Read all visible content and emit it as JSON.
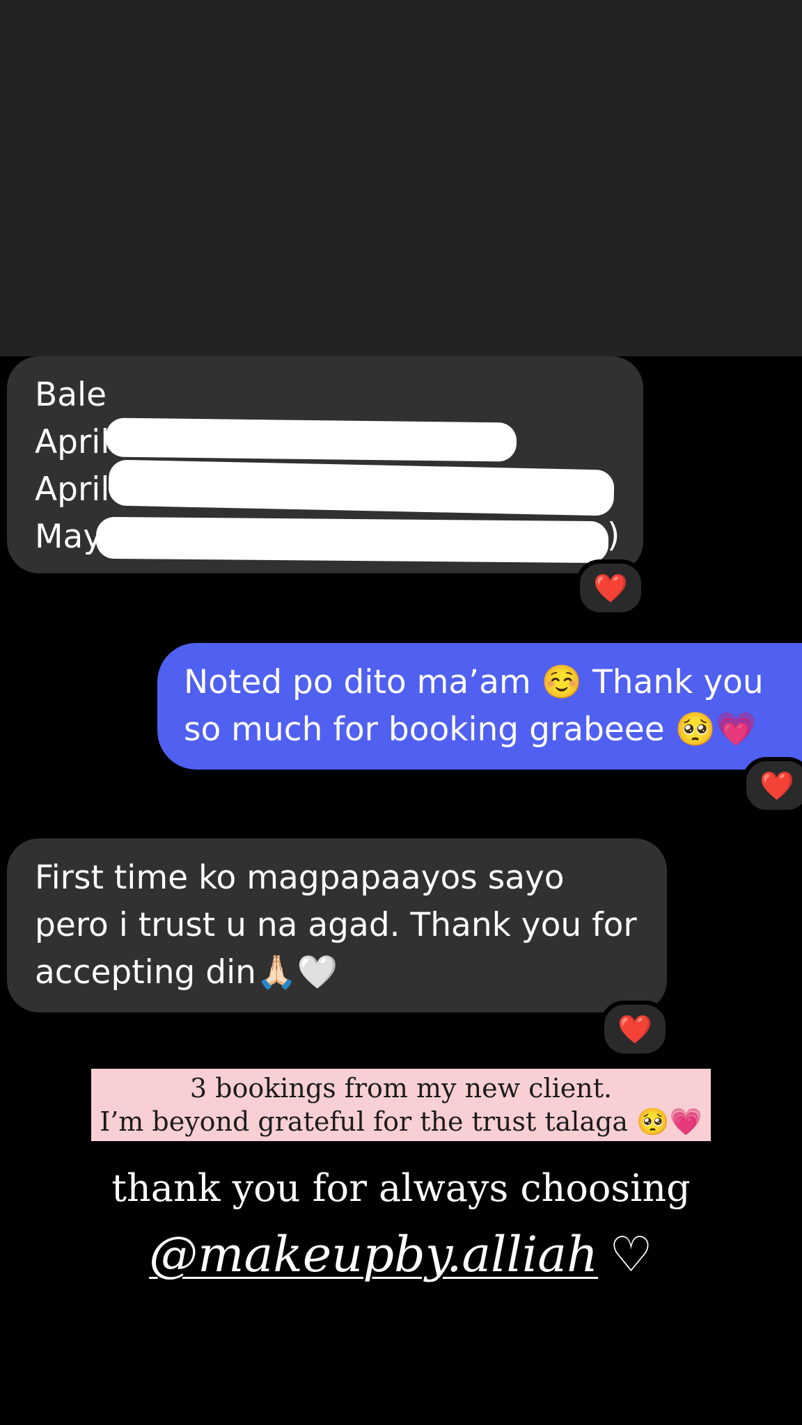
{
  "colors": {
    "top_band": "#232323",
    "background": "#000000",
    "incoming_bubble": "#313131",
    "outgoing_bubble": "#5060f0",
    "caption_bg": "#f8cfd3",
    "reaction": "#e5262d"
  },
  "messages": [
    {
      "direction": "incoming",
      "lines": [
        "Bale",
        "April",
        "April",
        "May",
        ")"
      ],
      "reaction": "❤️"
    },
    {
      "direction": "outgoing",
      "lines": [
        "Noted po dito ma’am ☺️  Thank you",
        "so much for booking grabeee 🥺💗"
      ],
      "reaction": "❤️"
    },
    {
      "direction": "incoming",
      "lines": [
        "First time ko magpapaayos sayo",
        "pero i trust u na agad. Thank you for",
        "accepting din🙏🏻🤍"
      ],
      "reaction": "❤️"
    }
  ],
  "caption": {
    "line1": "3 bookings from my new client.",
    "line2": "I’m beyond grateful for the trust talaga 🥺💗"
  },
  "footer": {
    "thanks": "thank you for always choosing",
    "handle": "@makeupby.alliah",
    "heart": "♡"
  }
}
